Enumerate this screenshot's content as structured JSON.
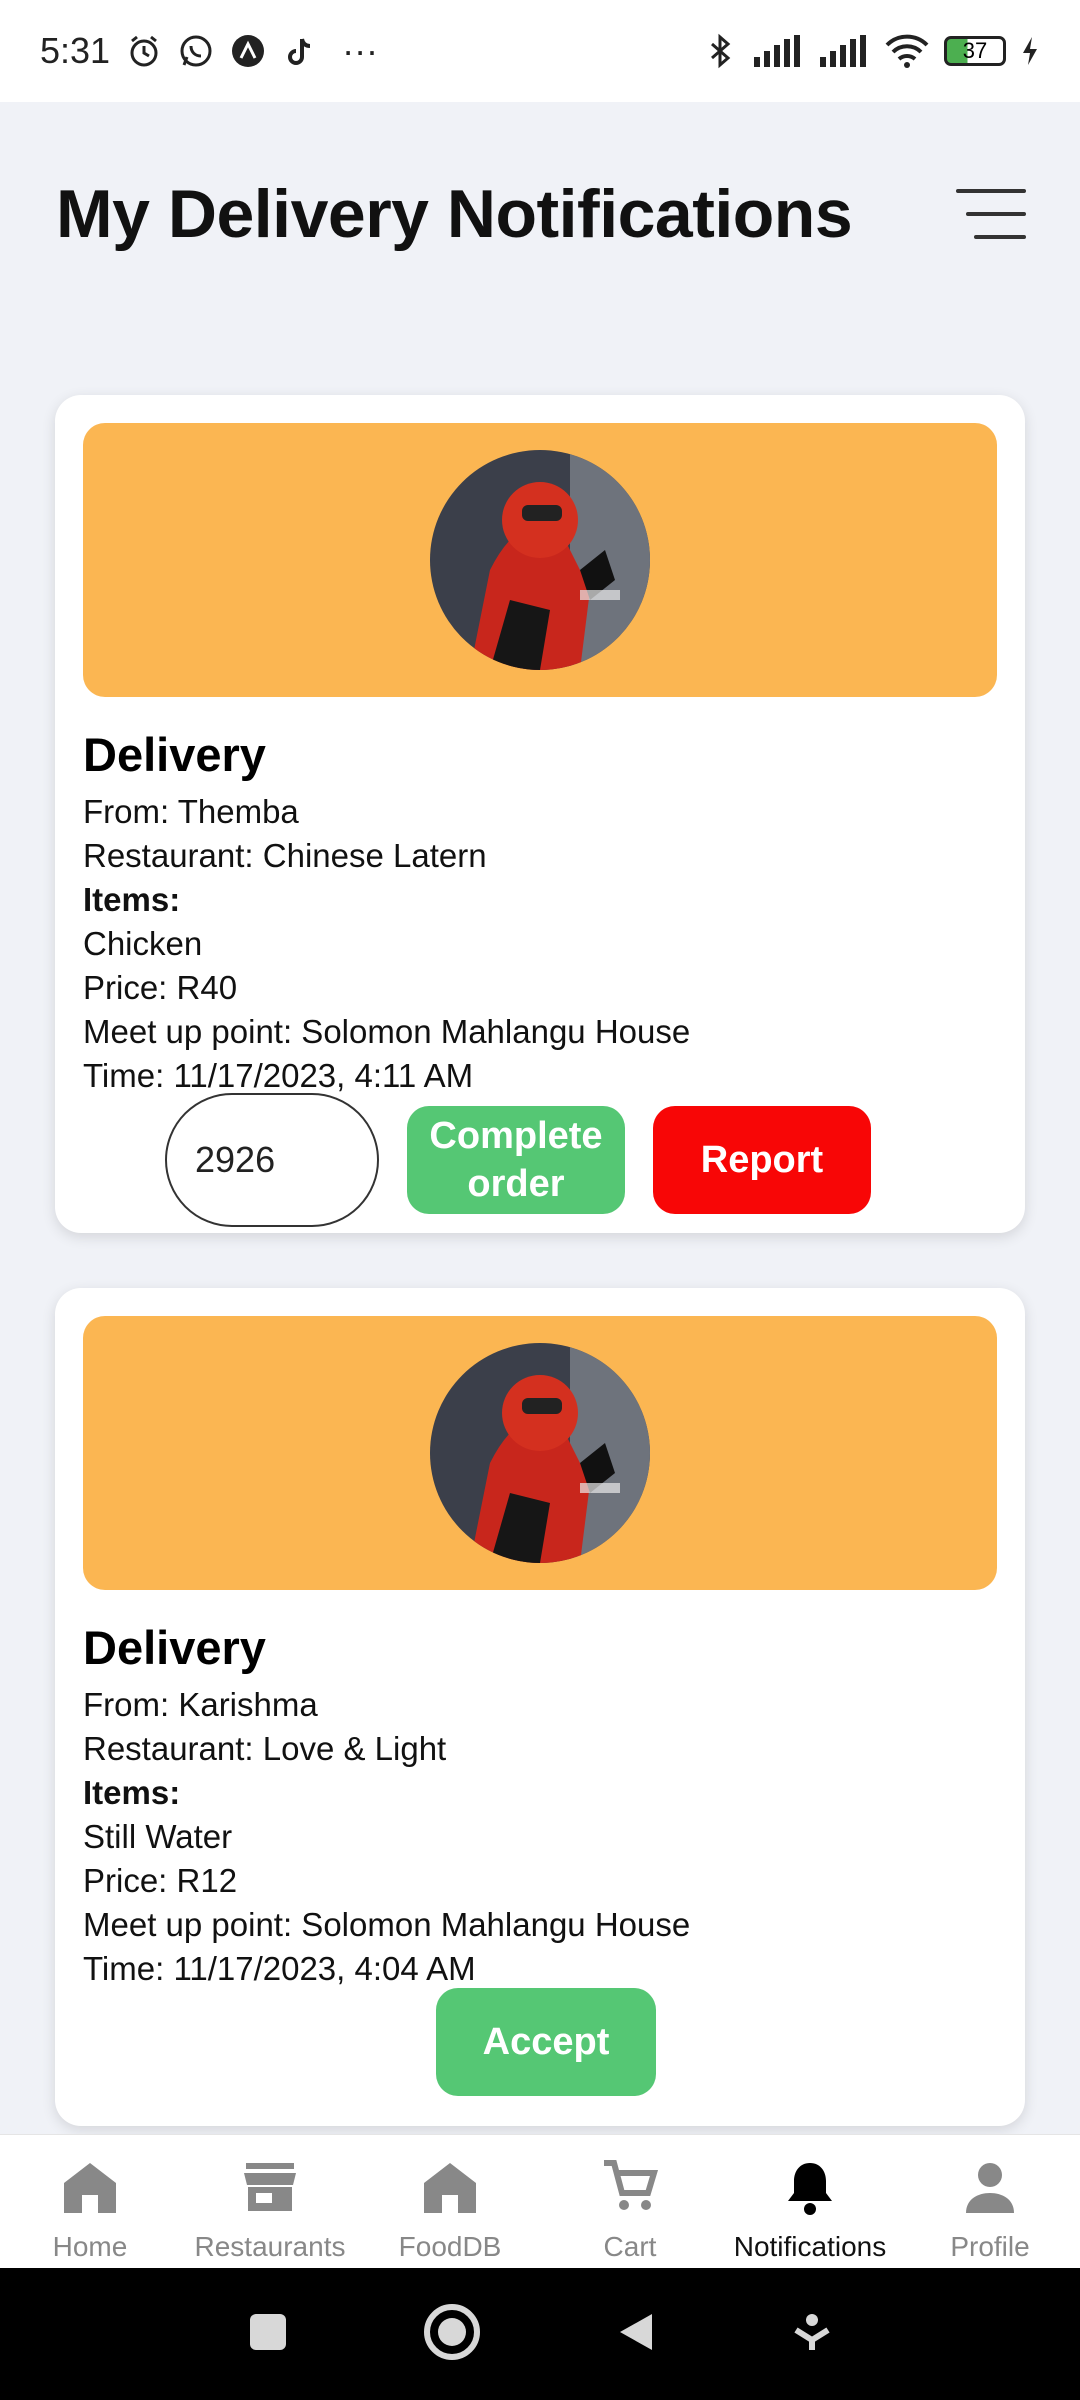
{
  "statusbar": {
    "time": "5:31",
    "more": "···",
    "battery": "37"
  },
  "header": {
    "title": "My Delivery Notifications"
  },
  "cards": [
    {
      "title": "Delivery",
      "from": "From: Themba",
      "restaurant": "Restaurant: Chinese Latern",
      "items_label": "Items:",
      "item": "Chicken",
      "price": "Price: R40",
      "meetup": "Meet up point: Solomon Mahlangu House",
      "time": "Time: 11/17/2023, 4:11 AM",
      "otp_value": "2926",
      "complete_label": "Complete order",
      "report_label": "Report"
    },
    {
      "title": "Delivery",
      "from": "From: Karishma",
      "restaurant": "Restaurant: Love & Light",
      "items_label": "Items:",
      "item": "Still Water",
      "price": "Price: R12",
      "meetup": "Meet up point: Solomon Mahlangu House",
      "time": "Time: 11/17/2023, 4:04 AM",
      "accept_label": "Accept"
    }
  ],
  "nav": [
    {
      "label": "Home",
      "icon": "home-icon"
    },
    {
      "label": "Restaurants",
      "icon": "store-icon"
    },
    {
      "label": "FoodDB",
      "icon": "home-icon"
    },
    {
      "label": "Cart",
      "icon": "cart-icon"
    },
    {
      "label": "Notifications",
      "icon": "bell-icon",
      "active": true
    },
    {
      "label": "Profile",
      "icon": "person-icon"
    }
  ],
  "colors": {
    "banner": "#fbb652",
    "green": "#55c774",
    "red": "#f80606"
  }
}
